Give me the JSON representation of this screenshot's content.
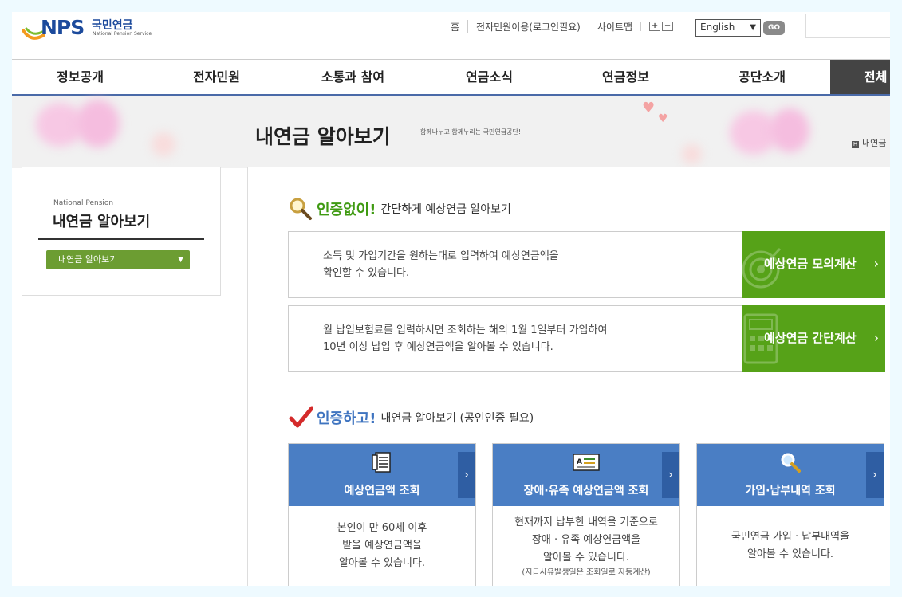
{
  "header": {
    "logo_text": "NPS",
    "logo_korean": "국민연금",
    "logo_english": "National Pension Service",
    "util_links": [
      "홈",
      "전자민원이용(로그인필요)",
      "사이트맵"
    ],
    "zoom_in": "+",
    "zoom_out": "−",
    "language_selected": "English",
    "go_label": "GO"
  },
  "gnb": [
    "정보공개",
    "전자민원",
    "소통과 참여",
    "연금소식",
    "연금정보",
    "공단소개",
    "전체"
  ],
  "page": {
    "title": "내연금 알아보기",
    "subtitle": "함께나누고 함께누리는 국민연금공단!",
    "breadcrumb": "내연금"
  },
  "side": {
    "english_label": "National Pension",
    "title": "내연금 알아보기",
    "menu_item": "내연금 알아보기"
  },
  "section1": {
    "emphasis": "인증없이!",
    "rest": "간단하게 예상연금 알아보기",
    "rows": [
      {
        "line1": "소득 및 가입기간을 원하는대로 입력하여 예상연금액을",
        "line2": "확인할 수 있습니다.",
        "button": "예상연금 모의계산"
      },
      {
        "line1": "월 납입보험료를 입력하시면 조회하는 해의 1월 1일부터 가입하여",
        "line2": "10년 이상 납입 후 예상연금액을 알아볼 수 있습니다.",
        "button": "예상연금 간단계산"
      }
    ]
  },
  "section2": {
    "emphasis": "인증하고!",
    "rest": "내연금 알아보기 (공인인증 필요)",
    "cards": [
      {
        "label": "예상연금액 조회",
        "lines": [
          "본인이 만 60세 이후",
          "받을 예상연금액을",
          "알아볼 수 있습니다."
        ],
        "note": ""
      },
      {
        "label": "장애·유족 예상연금액 조회",
        "lines": [
          "현재까지 납부한 내역을 기준으로",
          "장애 · 유족 예상연금액을",
          "알아볼 수 있습니다."
        ],
        "note": "(지급사유발생일은 조회일로 자동계산)"
      },
      {
        "label": "가입·납부내역 조회",
        "lines": [
          "국민연금 가입 · 납부내역을",
          "알아볼 수 있습니다."
        ],
        "note": ""
      }
    ]
  },
  "colors": {
    "brand_blue": "#1c4a9c",
    "green_button": "#56a218",
    "card_blue": "#4a7ec4",
    "section1_emphasis": "#3f9a12",
    "section2_emphasis": "#3f74c0"
  }
}
